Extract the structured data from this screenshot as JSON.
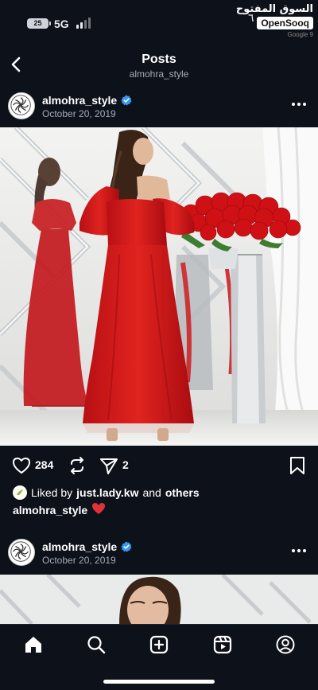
{
  "status_bar": {
    "battery": "25",
    "network": "5G",
    "clock": "٦",
    "watermark_arabic": "السوق المفتوح",
    "watermark_brand": "OpenSooq",
    "watermark_sub": "Google 9"
  },
  "header": {
    "title": "Posts",
    "subtitle": "almohra_style"
  },
  "posts": [
    {
      "username": "almohra_style",
      "date": "October 20, 2019",
      "likes_count": "284",
      "shares_count": "2",
      "liked_by_prefix": "Liked by",
      "liked_by_user": "just.lady.kw",
      "liked_by_joiner": "and",
      "liked_by_others": "others",
      "caption_user": "almohra_style",
      "caption_emoji": "❤️"
    },
    {
      "username": "almohra_style",
      "date": "October 20, 2019"
    }
  ],
  "nav": {
    "items": [
      "home-icon",
      "search-icon",
      "create-icon",
      "reels-icon",
      "profile-icon"
    ]
  },
  "colors": {
    "background": "#0d111a",
    "dress": "#d8171c",
    "verified": "#3897f0",
    "heart": "#e0313a"
  }
}
